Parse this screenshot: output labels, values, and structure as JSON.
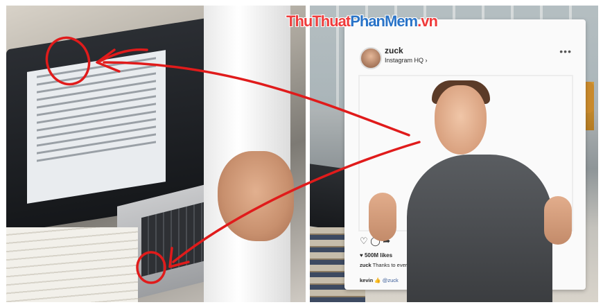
{
  "watermark": {
    "part1": "ThuThuat",
    "part2": "PhanMem",
    "part3": ".vn"
  },
  "instagram_frame": {
    "username": "zuck",
    "location": "Instagram HQ",
    "location_chevron": "›",
    "menu_dots": "•••",
    "action_icons": [
      "heart-icon",
      "comment-icon",
      "share-icon"
    ],
    "action_glyphs": "♡ ◯ ➦",
    "likes": "500M likes",
    "likes_heart": "♥",
    "caption_user": "zuck",
    "caption_text": "Thanks to everyone in our community for helping us reach this milestone!",
    "comment_user": "kevin",
    "comment_emoji": "👍",
    "comment_mention": "@zuck"
  },
  "annotation_color": "#e01b1b"
}
